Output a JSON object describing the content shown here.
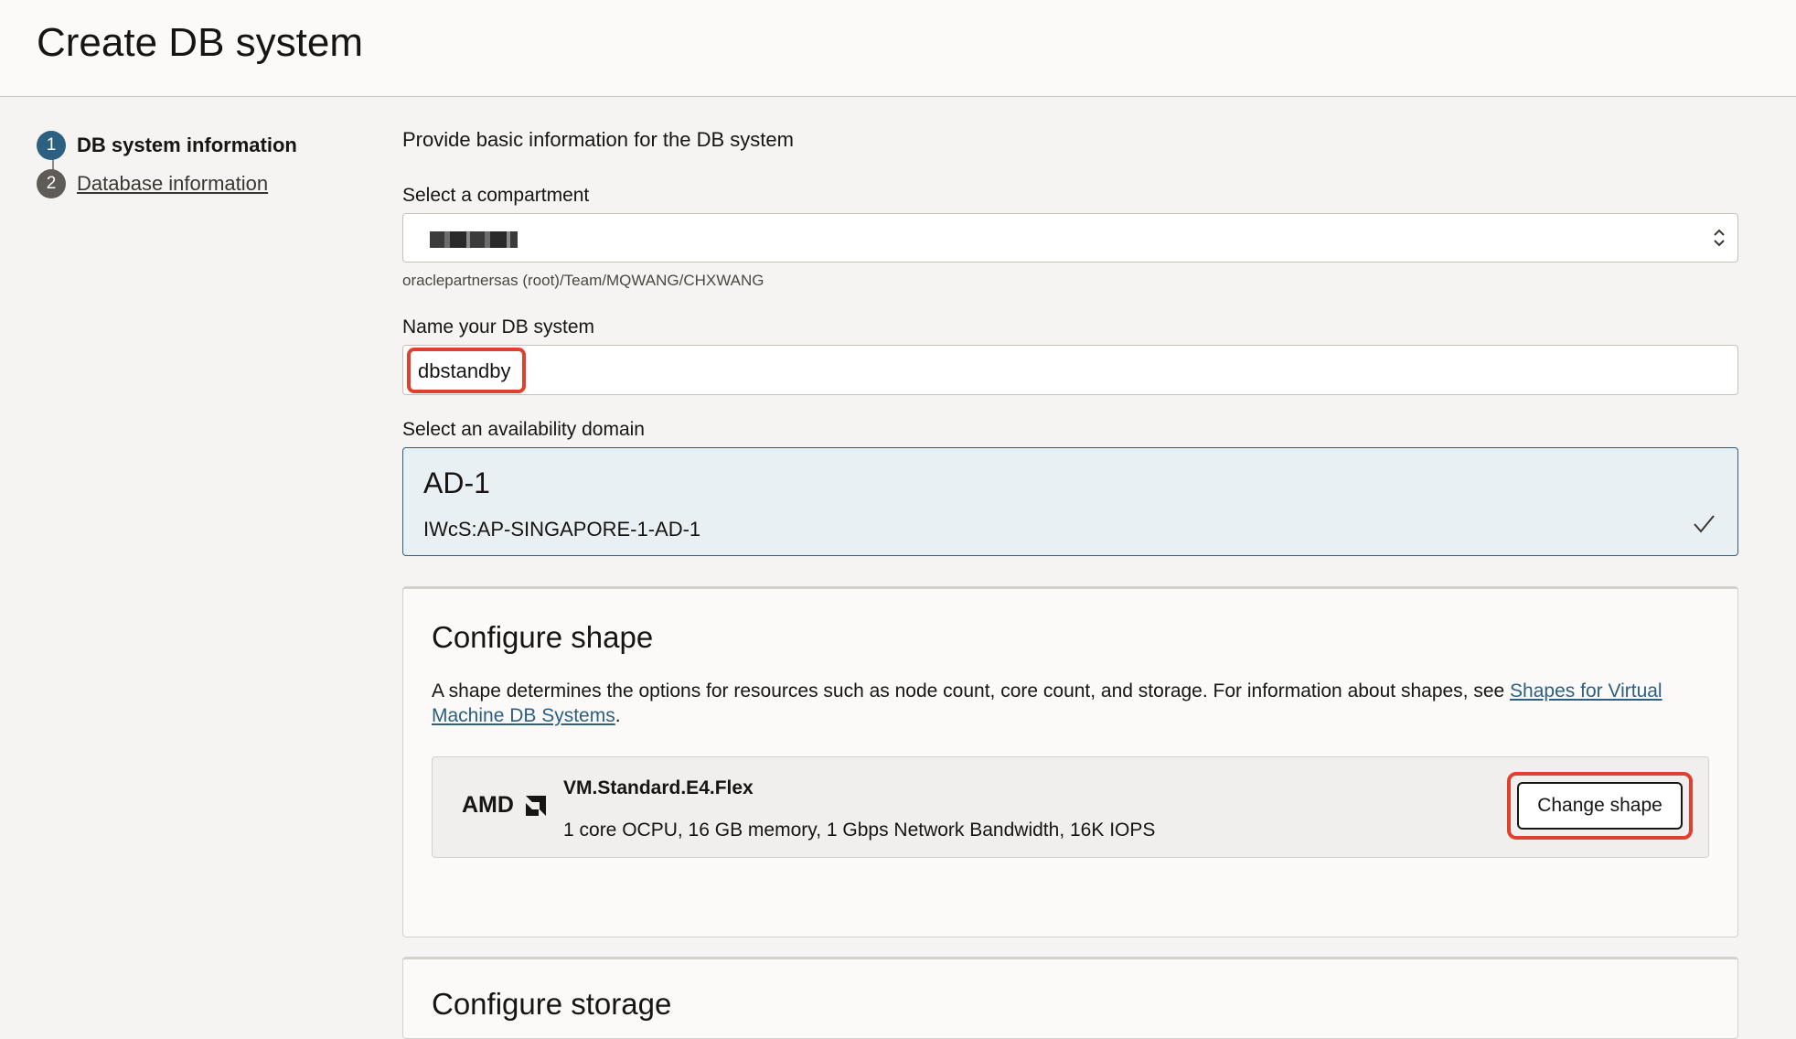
{
  "header": {
    "title": "Create DB system"
  },
  "steps": [
    {
      "number": "1",
      "label": "DB system information",
      "state": "active"
    },
    {
      "number": "2",
      "label": "Database information",
      "state": "inactive"
    }
  ],
  "form": {
    "intro": "Provide basic information for the DB system",
    "compartment": {
      "label": "Select a compartment",
      "path": "oraclepartnersas (root)/Team/MQWANG/CHXWANG"
    },
    "name": {
      "label": "Name your DB system",
      "value": "dbstandby"
    },
    "availability_domain": {
      "label": "Select an availability domain",
      "selected_title": "AD-1",
      "selected_subtitle": "IWcS:AP-SINGAPORE-1-AD-1"
    }
  },
  "configure_shape": {
    "title": "Configure shape",
    "description": "A shape determines the options for resources such as node count, core count, and storage. For information about shapes, see ",
    "link_text": "Shapes for Virtual Machine DB Systems",
    "description_end": ".",
    "shape": {
      "vendor_logo": "AMD",
      "name": "VM.Standard.E4.Flex",
      "details": "1 core OCPU, 16 GB memory, 1 Gbps Network Bandwidth, 16K IOPS"
    },
    "change_button": "Change shape"
  },
  "configure_storage": {
    "title": "Configure storage"
  },
  "colors": {
    "accent": "#2c5f80",
    "highlight": "#e0402e",
    "background": "#f5f4f2"
  }
}
